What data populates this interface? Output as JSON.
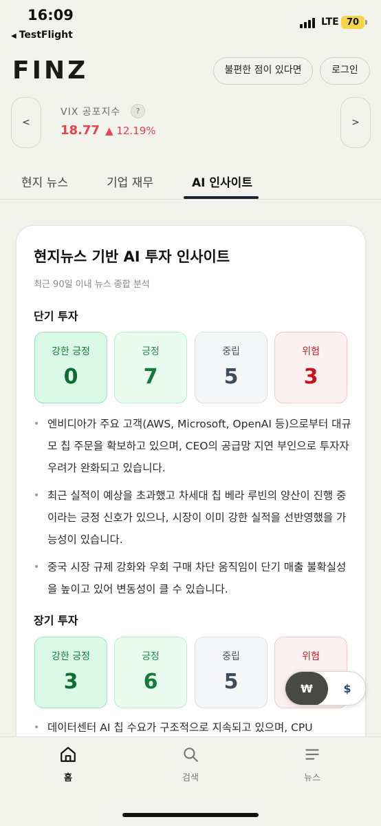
{
  "status_bar": {
    "time": "16:09",
    "back_app": "TestFlight",
    "network": "LTE",
    "battery": "70"
  },
  "header": {
    "logo": "FINZ",
    "complaint_button": "불편한 점이 있다면",
    "login_button": "로그인"
  },
  "ticker": {
    "prev": "<",
    "next": ">",
    "label": "VIX 공포지수",
    "help": "?",
    "value": "18.77",
    "change": "▲ 12.19%",
    "change_color": "#e8424b"
  },
  "tabs": [
    {
      "label": "현지 뉴스",
      "active": false
    },
    {
      "label": "기업 재무",
      "active": false
    },
    {
      "label": "AI 인사이트",
      "active": true
    }
  ],
  "insight": {
    "title": "현지뉴스 기반 AI 투자 인사이트",
    "subtitle": "최근 90일 이내 뉴스 종합 분석",
    "short_term": {
      "title": "단기 투자",
      "sentiments": [
        {
          "label": "강한 긍정",
          "count": "0"
        },
        {
          "label": "긍정",
          "count": "7"
        },
        {
          "label": "중립",
          "count": "5"
        },
        {
          "label": "위험",
          "count": "3"
        }
      ],
      "bullets": [
        "엔비디아가 주요 고객(AWS, Microsoft, OpenAI 등)으로부터 대규모 칩 주문을 확보하고 있으며, CEO의 공급망 지연 부인으로 투자자 우려가 완화되고 있습니다.",
        "최근 실적이 예상을 초과했고 차세대 칩 베라 루빈의 양산이 진행 중이라는 긍정 신호가 있으나, 시장이 이미 강한 실적을 선반영했을 가능성이 있습니다.",
        "중국 시장 규제 강화와 우회 구매 차단 움직임이 단기 매출 불확실성을 높이고 있어 변동성이 클 수 있습니다."
      ]
    },
    "long_term": {
      "title": "장기 투자",
      "sentiments": [
        {
          "label": "강한 긍정",
          "count": "3"
        },
        {
          "label": "긍정",
          "count": "6"
        },
        {
          "label": "중립",
          "count": "5"
        },
        {
          "label": "위험",
          "count": ""
        }
      ],
      "bullets": [
        "데이터센터 AI 칩 수요가 구조적으로 지속되고 있으며, CPU"
      ]
    }
  },
  "currency_toggle": {
    "won": "₩",
    "usd": "$"
  },
  "bottom_nav": [
    {
      "label": "홈",
      "icon": "home-icon",
      "active": true
    },
    {
      "label": "검색",
      "icon": "search-icon",
      "active": false
    },
    {
      "label": "뉴스",
      "icon": "news-icon",
      "active": false
    }
  ]
}
